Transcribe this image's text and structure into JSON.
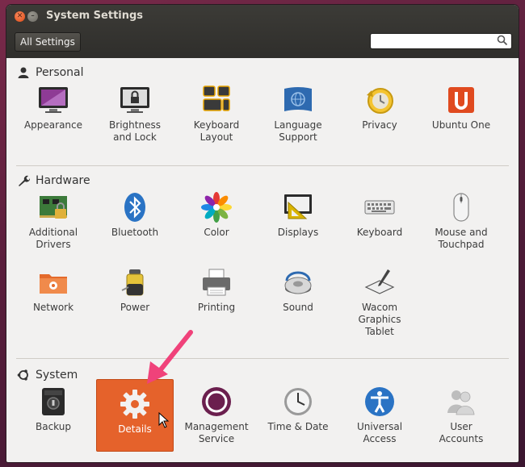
{
  "window": {
    "title": "System Settings",
    "all_settings_label": "All Settings",
    "search_placeholder": ""
  },
  "sections": [
    {
      "title": "Personal",
      "icon": "person-icon",
      "items": [
        {
          "label": "Appearance",
          "icon": "appearance-icon"
        },
        {
          "label": "Brightness\nand Lock",
          "icon": "brightness-lock-icon"
        },
        {
          "label": "Keyboard\nLayout",
          "icon": "keyboard-layout-icon"
        },
        {
          "label": "Language\nSupport",
          "icon": "language-support-icon"
        },
        {
          "label": "Privacy",
          "icon": "privacy-icon"
        },
        {
          "label": "Ubuntu One",
          "icon": "ubuntu-one-icon"
        }
      ]
    },
    {
      "title": "Hardware",
      "icon": "wrench-icon",
      "items": [
        {
          "label": "Additional\nDrivers",
          "icon": "additional-drivers-icon"
        },
        {
          "label": "Bluetooth",
          "icon": "bluetooth-icon"
        },
        {
          "label": "Color",
          "icon": "color-icon"
        },
        {
          "label": "Displays",
          "icon": "displays-icon"
        },
        {
          "label": "Keyboard",
          "icon": "keyboard-icon"
        },
        {
          "label": "Mouse and\nTouchpad",
          "icon": "mouse-icon"
        },
        {
          "label": "Network",
          "icon": "network-icon"
        },
        {
          "label": "Power",
          "icon": "power-icon"
        },
        {
          "label": "Printing",
          "icon": "printer-icon"
        },
        {
          "label": "Sound",
          "icon": "sound-icon"
        },
        {
          "label": "Wacom\nGraphics\nTablet",
          "icon": "wacom-tablet-icon"
        }
      ]
    },
    {
      "title": "System",
      "icon": "ubuntu-logo-icon",
      "items": [
        {
          "label": "Backup",
          "icon": "backup-icon"
        },
        {
          "label": "Details",
          "icon": "details-gear-icon",
          "selected": true
        },
        {
          "label": "Management\nService",
          "icon": "management-service-icon"
        },
        {
          "label": "Time & Date",
          "icon": "clock-icon"
        },
        {
          "label": "Universal\nAccess",
          "icon": "universal-access-icon"
        },
        {
          "label": "User\nAccounts",
          "icon": "user-accounts-icon"
        }
      ]
    }
  ],
  "colors": {
    "selection": "#e5622b",
    "arrow": "#f0427a",
    "titlebar": "#3c3b37"
  }
}
